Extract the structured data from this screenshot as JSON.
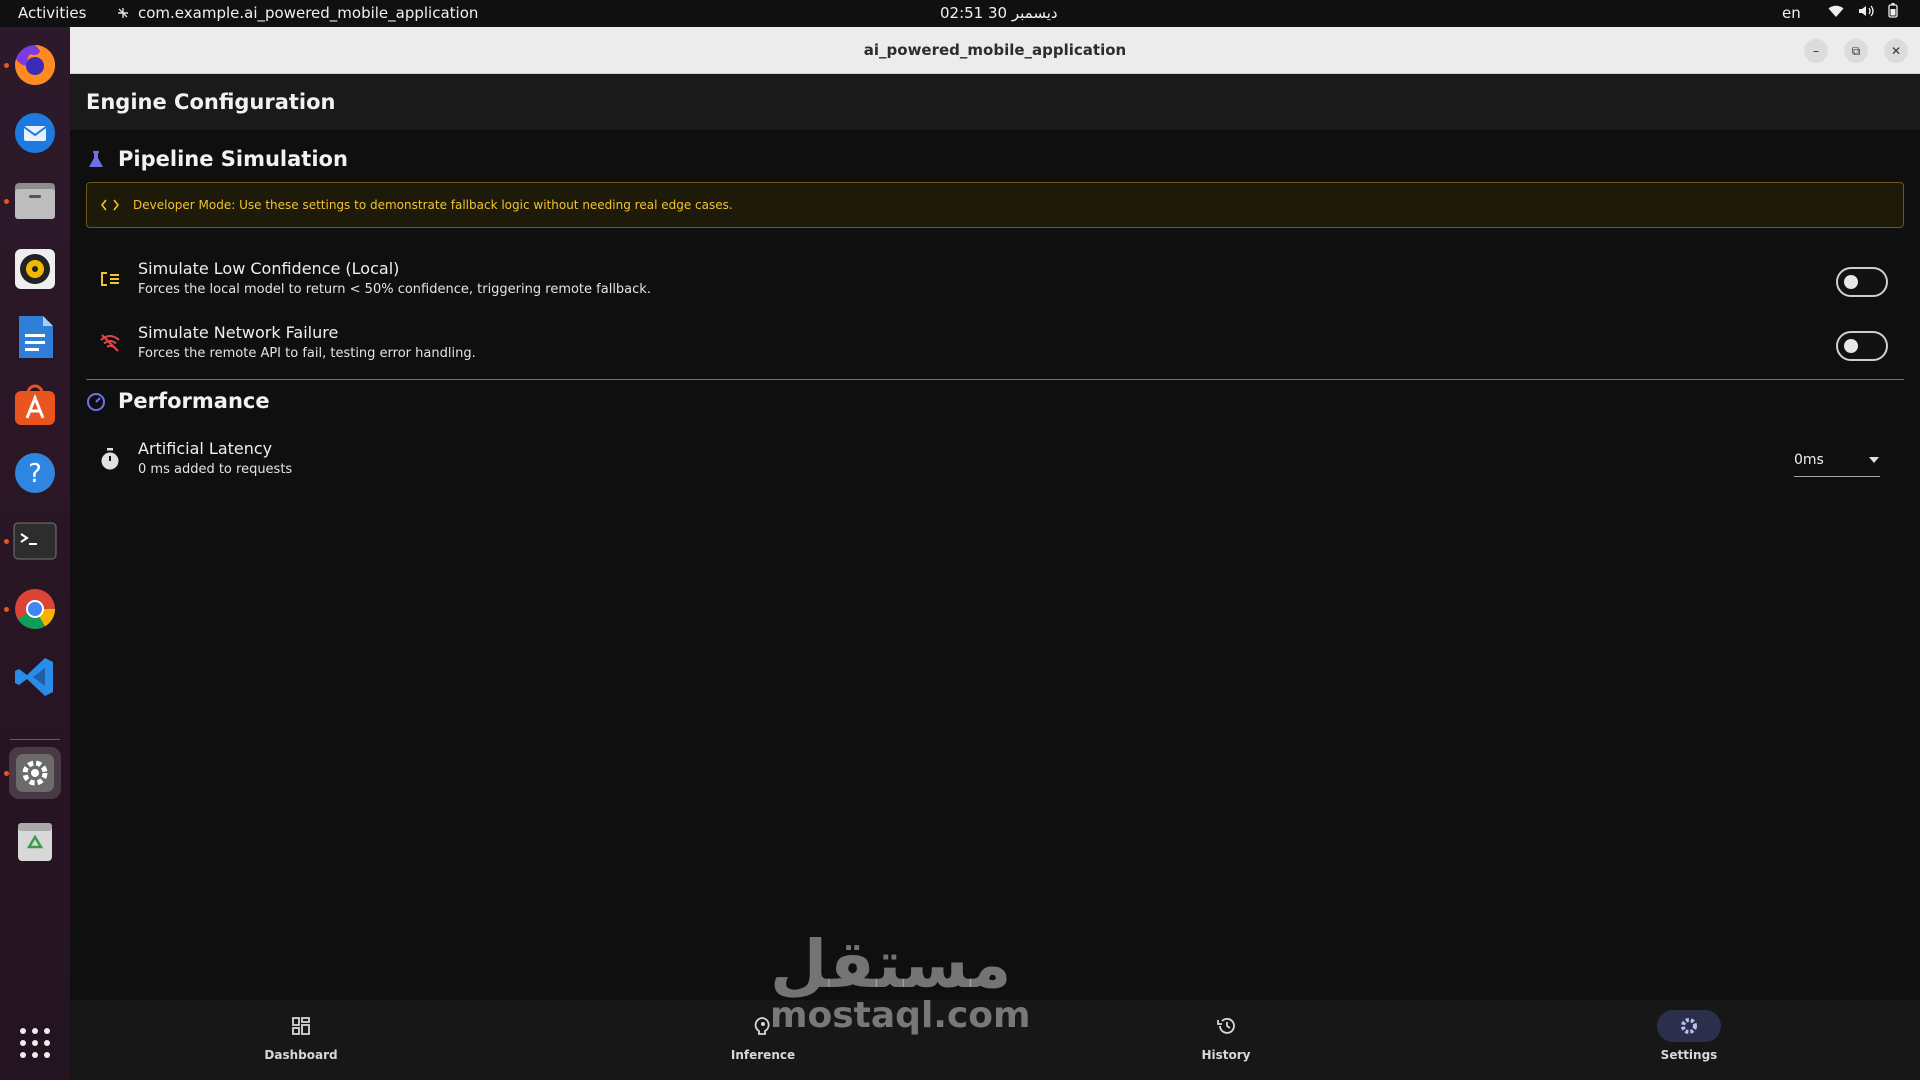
{
  "topbar": {
    "activities": "Activities",
    "app_name": "com.example.ai_powered_mobile_application",
    "clock": "02:51  30 ديسمبر",
    "lang": "en"
  },
  "dock": {
    "items": [
      "Firefox",
      "Thunderbird",
      "Files",
      "Rhythmbox",
      "LibreOffice Writer",
      "Ubuntu Software",
      "Help",
      "Terminal",
      "Chrome",
      "VS Code",
      "Settings",
      "Trash"
    ]
  },
  "window": {
    "title": "ai_powered_mobile_application"
  },
  "appbar": {
    "title": "Engine Configuration"
  },
  "pipeline": {
    "heading": "Pipeline Simulation",
    "notice": "Developer Mode: Use these settings to demonstrate fallback logic without needing real edge cases.",
    "low_confidence": {
      "title": "Simulate Low Confidence (Local)",
      "subtitle": "Forces the local model to return < 50% confidence, triggering remote fallback.",
      "enabled": false
    },
    "network_failure": {
      "title": "Simulate Network Failure",
      "subtitle": "Forces the remote API to fail, testing error handling.",
      "enabled": false
    }
  },
  "performance": {
    "heading": "Performance",
    "latency": {
      "title": "Artificial Latency",
      "subtitle": "0 ms added to requests",
      "selected": "0ms"
    }
  },
  "nav": {
    "dashboard": "Dashboard",
    "inference": "Inference",
    "history": "History",
    "settings": "Settings"
  },
  "watermark": {
    "arabic": "مستقل",
    "latin": "mostaql.com"
  },
  "colors": {
    "accent": "#6f6fe0",
    "warning": "#f2c230",
    "danger": "#e04848",
    "active_nav": "#2b2f4c"
  }
}
